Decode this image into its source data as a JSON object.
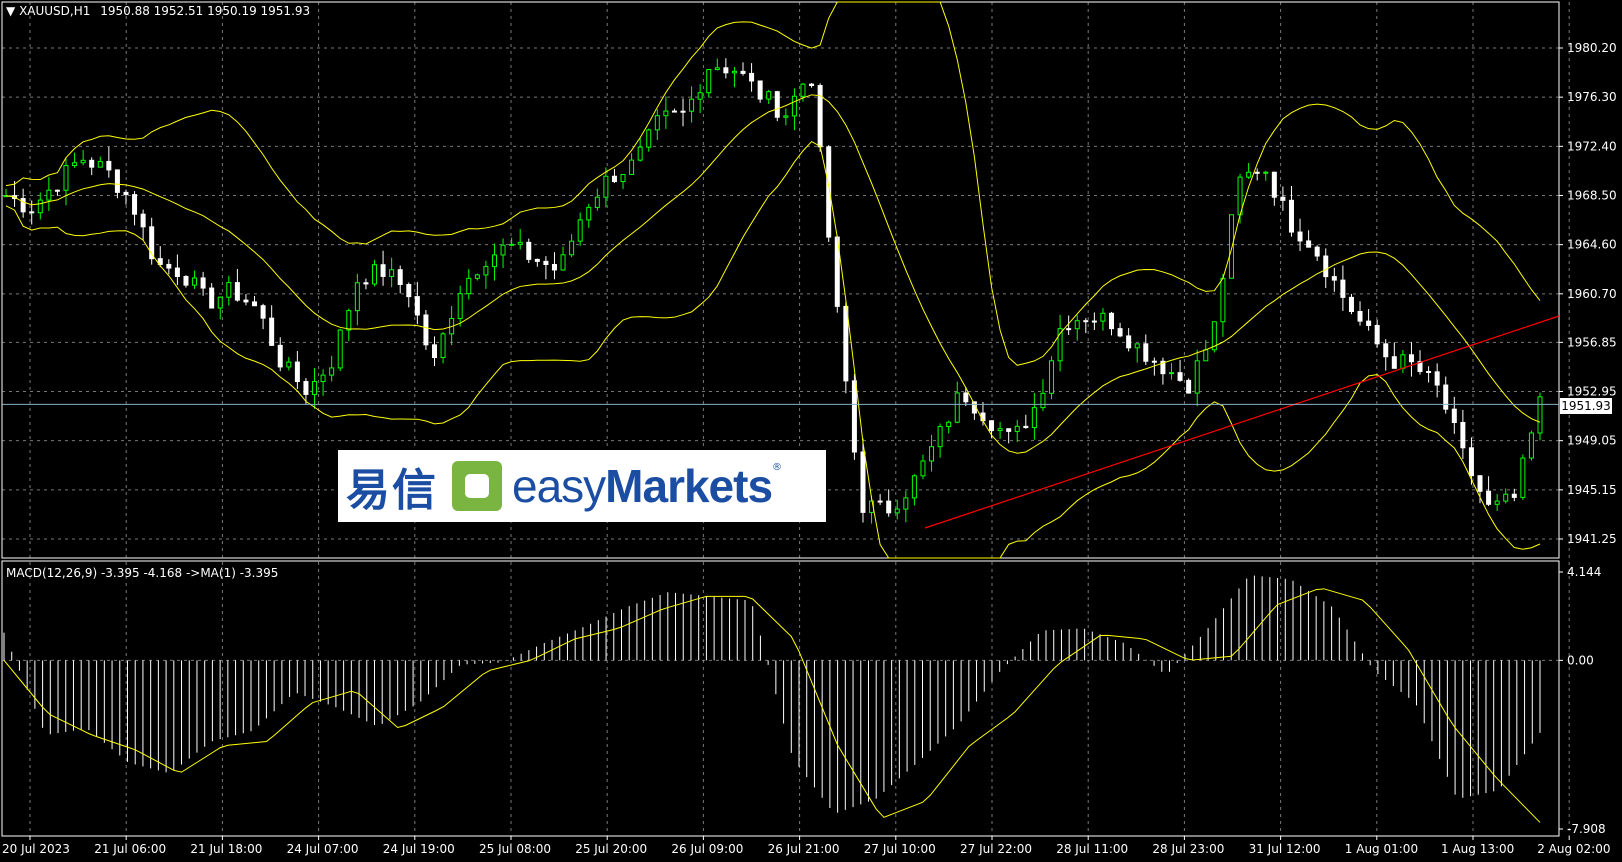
{
  "header": {
    "symbol_label": "XAUUSD,H1",
    "ohlc": "1950.88 1952.51 1950.19 1951.93"
  },
  "macd": {
    "label": "MACD(12,26,9) -3.395 -4.168 ->MA(1) -3.395",
    "axis": [
      "4.144",
      "0.00",
      "-7.908"
    ]
  },
  "price_axis": [
    "1980.20",
    "1976.30",
    "1972.40",
    "1968.50",
    "1964.60",
    "1960.70",
    "1956.85",
    "1952.95",
    "1949.05",
    "1945.15",
    "1941.25"
  ],
  "current_price": "1951.93",
  "time_axis": [
    "20 Jul 2023",
    "21 Jul 06:00",
    "21 Jul 18:00",
    "24 Jul 07:00",
    "24 Jul 19:00",
    "25 Jul 08:00",
    "25 Jul 20:00",
    "26 Jul 09:00",
    "26 Jul 21:00",
    "27 Jul 10:00",
    "27 Jul 22:00",
    "28 Jul 11:00",
    "28 Jul 23:00",
    "31 Jul 12:00",
    "1 Aug 01:00",
    "1 Aug 13:00",
    "2 Aug 02:00"
  ],
  "logo": {
    "cn": "易信",
    "en_light": "easy",
    "en_bold": "Markets",
    "reg": "®"
  },
  "colors": {
    "bull": "#00ff00",
    "bear": "#ffffff",
    "bands": "#ffff00",
    "trendline": "#ff0000",
    "macd_signal": "#ffff00",
    "grid": "#c8c8c8"
  },
  "chart_data": {
    "type": "candlestick",
    "symbol": "XAUUSD",
    "timeframe": "H1",
    "ylim": [
      1939.5,
      1984.0
    ],
    "close_path": [
      1968.5,
      1967.5,
      1969.5,
      1971.5,
      1970.5,
      1968.0,
      1963.0,
      1962.5,
      1960.0,
      1961.0,
      1959.5,
      1955.0,
      1953.0,
      1955.5,
      1962.0,
      1962.5,
      1961.0,
      1955.0,
      1961.0,
      1963.5,
      1964.5,
      1963.5,
      1962.5,
      1967.5,
      1970.0,
      1971.0,
      1974.5,
      1975.0,
      1979.0,
      1978.5,
      1976.5,
      1975.0,
      1978.5,
      1960.0,
      1944.0,
      1943.5,
      1945.5,
      1949.0,
      1953.0,
      1951.0,
      1949.0,
      1952.0,
      1958.5,
      1959.0,
      1958.5,
      1956.5,
      1955.0,
      1953.5,
      1957.5,
      1969.5,
      1971.0,
      1966.5,
      1964.5,
      1961.0,
      1958.0,
      1955.5,
      1955.0,
      1953.0,
      1947.5,
      1943.5,
      1944.5,
      1952.0
    ],
    "macd_path": [
      1.3,
      -3.5,
      -3.2,
      -4.8,
      -5.3,
      -3.8,
      -3.3,
      -1.5,
      -2.2,
      -3.1,
      -2.0,
      -0.2,
      -0.1,
      0.8,
      1.6,
      2.5,
      3.2,
      3.0,
      2.8,
      -4.6,
      -7.2,
      -6.5,
      -4.8,
      -3.0,
      -0.5,
      1.4,
      1.5,
      0.8,
      -0.7,
      1.5,
      4.0,
      3.8,
      2.5,
      -0.5,
      -2.0,
      -6.5,
      -6.1,
      -3.4
    ],
    "signal_path": [
      0.0,
      -2.5,
      -3.5,
      -4.2,
      -5.3,
      -4.0,
      -3.8,
      -2.0,
      -1.4,
      -3.2,
      -2.2,
      -0.5,
      0.0,
      1.0,
      1.5,
      2.4,
      3.0,
      3.0,
      1.0,
      -4.0,
      -7.4,
      -6.6,
      -4.0,
      -2.5,
      -0.2,
      1.2,
      1.0,
      0.0,
      0.2,
      2.6,
      3.4,
      2.8,
      0.5,
      -3.0,
      -5.5,
      -7.6
    ]
  }
}
